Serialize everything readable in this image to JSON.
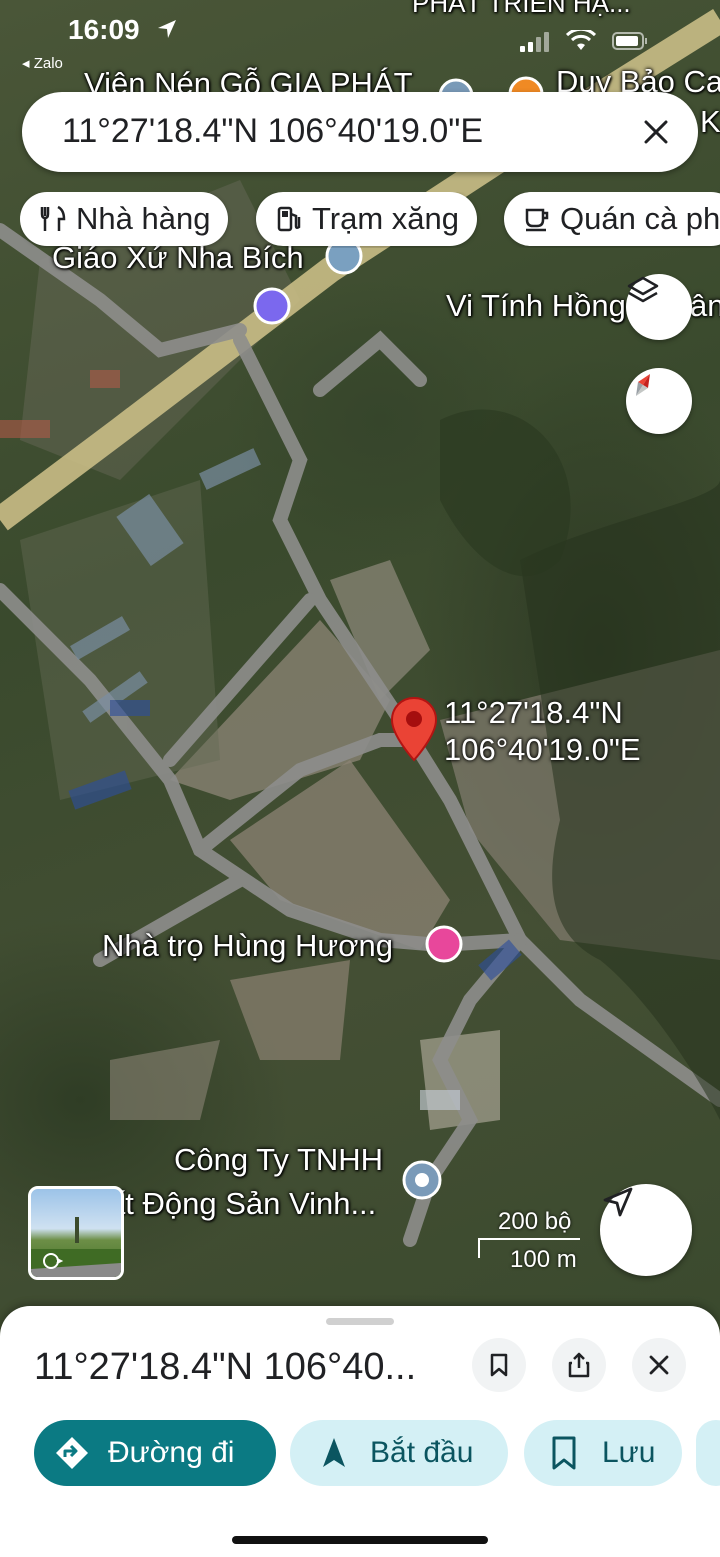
{
  "status_bar": {
    "time": "16:09",
    "back_app": "◂ Zalo"
  },
  "search": {
    "query": "11°27'18.4\"N 106°40'19.0\"E"
  },
  "chips": [
    {
      "icon": "restaurant-icon",
      "label": "Nhà hàng"
    },
    {
      "icon": "gas-station-icon",
      "label": "Trạm xăng"
    },
    {
      "icon": "coffee-icon",
      "label": "Quán cà ph"
    }
  ],
  "map_labels": {
    "top_left": "Viên Nén Gỗ GIA PHÁT",
    "top_right": "Duy Bảo Ca",
    "top_right_2": "K",
    "top_center": "PHÁT TRIỂN HẠ...",
    "church": "Giáo Xứ Nha Bích",
    "computer": "Vi Tính Hồng",
    "computer_tail": "ân",
    "motel": "Nhà trọ Hùng Hương",
    "company_1": "Công Ty TNHH",
    "company_2": "ất Động Sản Vinh..."
  },
  "pin": {
    "lat": "11°27'18.4\"N",
    "lng": "106°40'19.0\"E",
    "color": "#ea4335"
  },
  "scale": {
    "imperial": "200 bộ",
    "metric": "100 m"
  },
  "sheet": {
    "title": "11°27'18.4\"N 106°40...",
    "actions": [
      {
        "icon": "directions-icon",
        "label": "Đường đi",
        "bg": "#0b7a83",
        "fg": "#ffffff"
      },
      {
        "icon": "navigation-arrow-icon",
        "label": "Bắt đầu",
        "bg": "#d4f0f5",
        "fg": "#0b5560"
      },
      {
        "icon": "bookmark-icon",
        "label": "Lưu",
        "bg": "#d4f0f5",
        "fg": "#0b5560"
      }
    ]
  }
}
